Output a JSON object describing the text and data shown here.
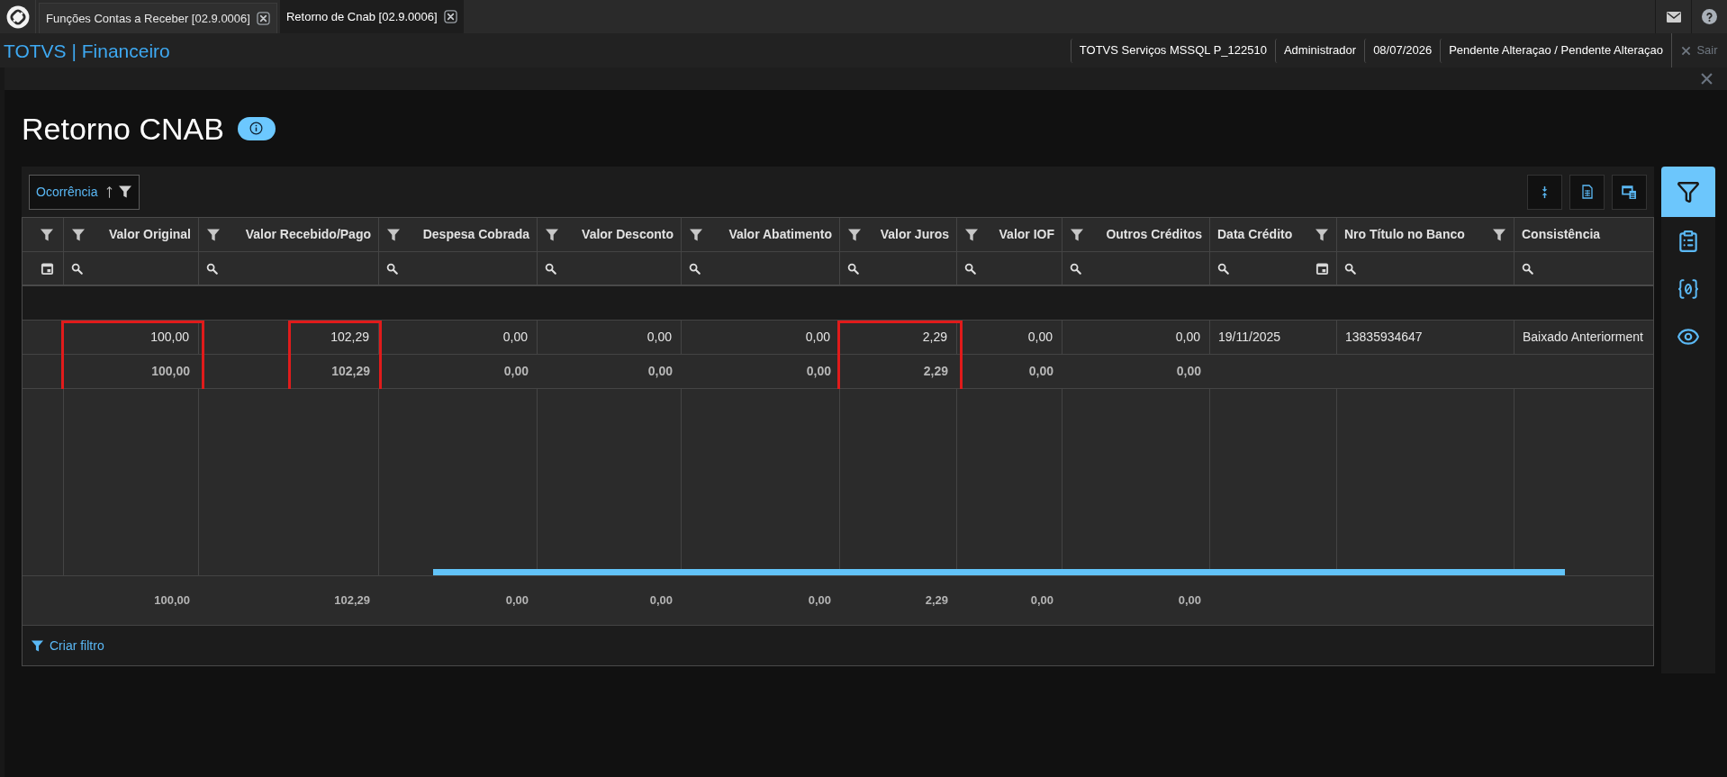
{
  "tabs": [
    {
      "label": "Funções Contas a Receber [02.9.0006]",
      "selected": false
    },
    {
      "label": "Retorno de Cnab [02.9.0006]",
      "selected": true
    }
  ],
  "app_title": "TOTVS | Financeiro",
  "session_info": [
    "TOTVS Serviços MSSQL P_122510",
    "Administrador",
    "08/07/2026",
    "Pendente Alteraçao / Pendente Alteraçao"
  ],
  "logout": {
    "label": "Sair",
    "disabled": true
  },
  "page": {
    "title": "Retorno CNAB"
  },
  "grid": {
    "group_by": {
      "label": "Ocorrência",
      "ascending": true
    },
    "toolbar_buttons": [
      {
        "kind": "collapse"
      },
      {
        "kind": "export"
      },
      {
        "kind": "layout"
      }
    ],
    "partial_column": {
      "kind": "date",
      "filterable": true
    },
    "columns": [
      {
        "label": "Valor Original",
        "kind": "number",
        "filterable": true,
        "highlighted": true
      },
      {
        "label": "Valor Recebido/Pago",
        "kind": "number",
        "filterable": true,
        "highlighted": true
      },
      {
        "label": "Despesa Cobrada",
        "kind": "number",
        "filterable": true,
        "highlighted": false
      },
      {
        "label": "Valor Desconto",
        "kind": "number",
        "filterable": true,
        "highlighted": false
      },
      {
        "label": "Valor Abatimento",
        "kind": "number",
        "filterable": true,
        "highlighted": false
      },
      {
        "label": "Valor Juros",
        "kind": "number",
        "filterable": true,
        "highlighted": true
      },
      {
        "label": "Valor IOF",
        "kind": "number",
        "filterable": true,
        "highlighted": false
      },
      {
        "label": "Outros Créditos",
        "kind": "number",
        "filterable": true,
        "highlighted": false
      },
      {
        "label": "Data Crédito",
        "kind": "date",
        "filterable": true,
        "highlighted": false
      },
      {
        "label": "Nro Título no Banco",
        "kind": "text",
        "filterable": true,
        "highlighted": false
      },
      {
        "label": "Consistência",
        "kind": "text",
        "filterable": false,
        "highlighted": false
      }
    ],
    "rows": [
      {
        "kind": "group"
      },
      {
        "kind": "data",
        "cells": [
          "100,00",
          "102,29",
          "0,00",
          "0,00",
          "0,00",
          "2,29",
          "0,00",
          "0,00",
          "19/11/2025",
          "13835934647",
          "Baixado Anteriorment"
        ]
      },
      {
        "kind": "subtotal",
        "cells": [
          "100,00",
          "102,29",
          "0,00",
          "0,00",
          "0,00",
          "2,29",
          "0,00",
          "0,00"
        ]
      }
    ],
    "totals": [
      "100,00",
      "102,29",
      "0,00",
      "0,00",
      "0,00",
      "2,29",
      "0,00",
      "0,00"
    ],
    "create_filter": "Criar filtro"
  },
  "side_toolbar": [
    {
      "kind": "filter",
      "selected": true
    },
    {
      "kind": "clipboard",
      "selected": false
    },
    {
      "kind": "variables",
      "selected": false
    },
    {
      "kind": "preview",
      "selected": false
    }
  ]
}
